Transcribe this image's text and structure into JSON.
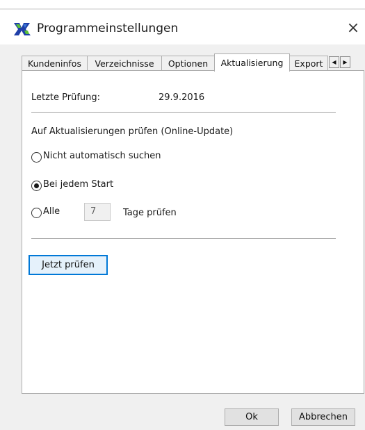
{
  "window": {
    "title": "Programmeinstellungen",
    "close_glyph": "×",
    "app_icon": "programmeinstellungen-app-icon"
  },
  "tabs": [
    {
      "label": "Kundeninfos",
      "active": false
    },
    {
      "label": "Verzeichnisse",
      "active": false
    },
    {
      "label": "Optionen",
      "active": false
    },
    {
      "label": "Aktualisierung",
      "active": true
    },
    {
      "label": "Export",
      "active": false
    }
  ],
  "tab_scroll": {
    "left_glyph": "◀",
    "right_glyph": "▶"
  },
  "panel": {
    "last_check_label": "Letzte Prüfung:",
    "last_check_value": "29.9.2016",
    "section_title": "Auf Aktualisierungen prüfen (Online-Update)",
    "options": [
      {
        "label": "Nicht automatisch suchen",
        "selected": false
      },
      {
        "label": "Bei jedem Start",
        "selected": true
      },
      {
        "label": "Alle",
        "selected": false
      }
    ],
    "days_value": "7",
    "days_suffix": "Tage prüfen",
    "check_now_button": "Jetzt prüfen"
  },
  "footer": {
    "ok_label": "Ok",
    "cancel_label": "Abbrechen"
  },
  "colors": {
    "accent_focus": "#0078d7",
    "window_bg": "#f0f0f0",
    "panel_bg": "#ffffff"
  }
}
